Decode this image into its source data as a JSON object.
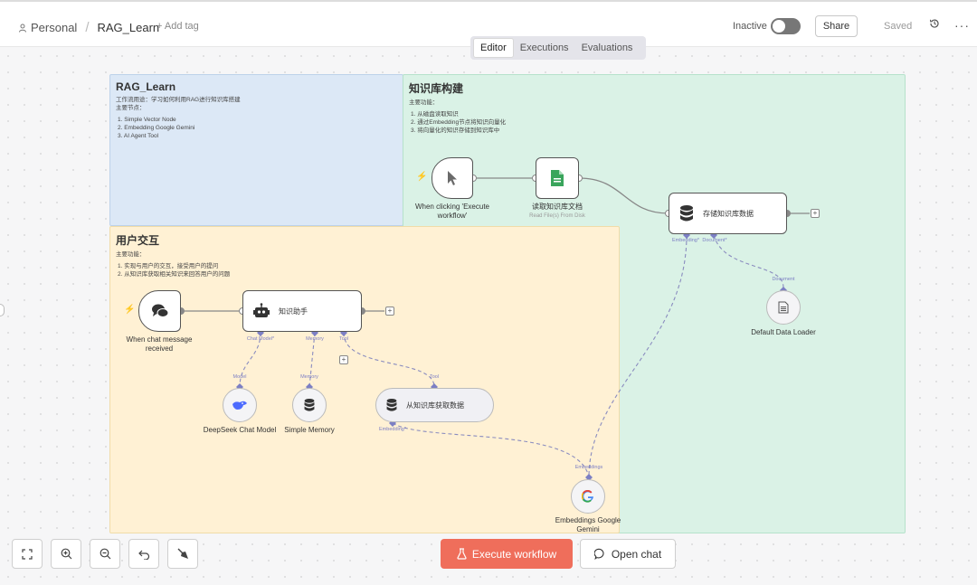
{
  "header": {
    "project": "Personal",
    "separator": "/",
    "workflow_name": "RAG_Learn",
    "add_tag": "+ Add tag",
    "status_label": "Inactive",
    "share_label": "Share",
    "saved_label": "Saved"
  },
  "tabs": [
    {
      "label": "Editor",
      "active": true
    },
    {
      "label": "Executions",
      "active": false
    },
    {
      "label": "Evaluations",
      "active": false
    }
  ],
  "notes": {
    "intro": {
      "title": "RAG_Learn",
      "lines": [
        "工作流用途：学习如何利用RAG进行知识库搭建",
        "主要节点：",
        "1. Simple Vector Node",
        "2. Embedding Google Gemini",
        "3. AI Agent Tool"
      ]
    },
    "kb": {
      "title": "知识库构建",
      "lines": [
        "主要功能：",
        "1. 从磁盘读取知识",
        "2. 通过Embedding节点将知识向量化",
        "3. 将向量化的知识存储到知识库中"
      ]
    },
    "user": {
      "title": "用户交互",
      "lines": [
        "主要功能：",
        "1. 实现与用户的交互，接受用户的提问",
        "2. 从知识库获取相关知识来回答用户的问题"
      ]
    }
  },
  "nodes": {
    "manual_trigger": {
      "label": "When clicking 'Execute workflow'"
    },
    "read_file": {
      "label": "读取知识库文档",
      "sub": "Read File(s) From Disk"
    },
    "vector_store": {
      "label": "存储知识库数据",
      "port_embedding": "Embedding*",
      "port_document": "Document*"
    },
    "data_loader": {
      "label": "Default Data Loader",
      "port": "Document"
    },
    "chat_trigger": {
      "label": "When chat message received"
    },
    "agent": {
      "label": "知识助手",
      "port_chat_model": "Chat Model*",
      "port_memory": "Memory",
      "port_tool": "Tool"
    },
    "deepseek": {
      "label": "DeepSeek Chat Model",
      "port": "Model"
    },
    "memory": {
      "label": "Simple Memory",
      "port": "Memory"
    },
    "kb_tool": {
      "label": "从知识库获取数据",
      "port_tool": "Tool",
      "port_embedding": "Embedding*"
    },
    "gemini": {
      "label": "Embeddings Google Gemini",
      "port": "Embeddings"
    }
  },
  "footer": {
    "execute_label": "Execute workflow",
    "open_chat_label": "Open chat"
  },
  "colors": {
    "accent": "#ef6e5b",
    "note_blue": "#dce8f6",
    "note_green": "#daf2e6",
    "note_yellow": "#fff1d4",
    "port": "#7c7fc4"
  }
}
